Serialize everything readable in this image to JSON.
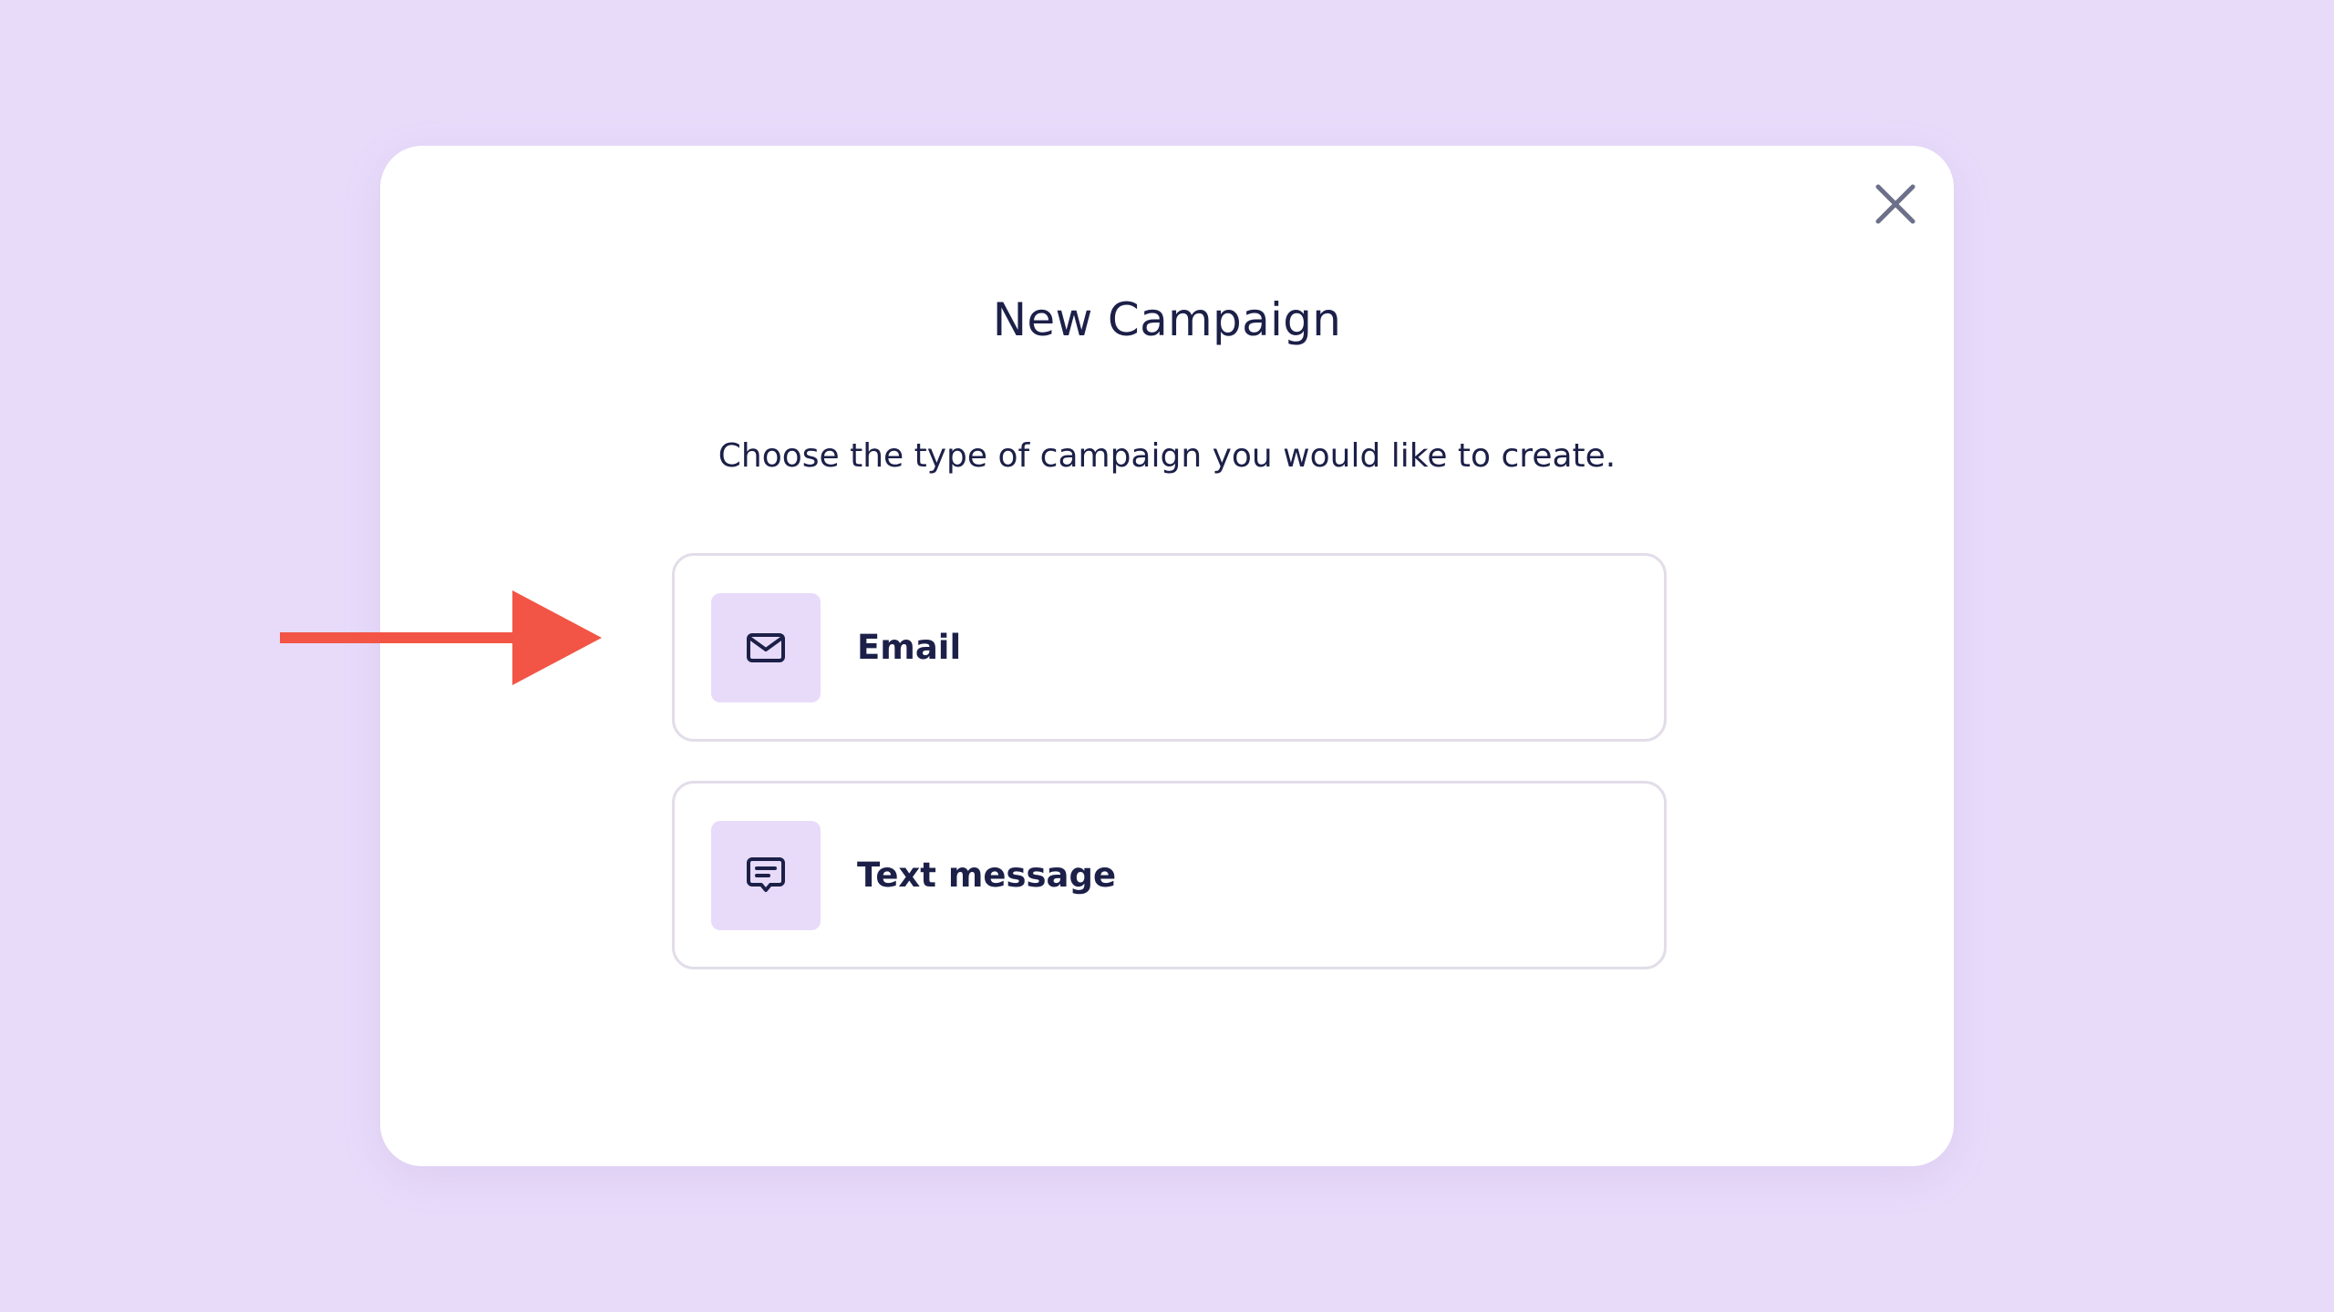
{
  "modal": {
    "title": "New Campaign",
    "subtitle": "Choose the type of campaign you would like to create.",
    "close_icon": "close-icon",
    "options": [
      {
        "label": "Email",
        "icon": "envelope-icon"
      },
      {
        "label": "Text message",
        "icon": "chat-message-icon"
      }
    ]
  },
  "annotation": {
    "icon": "arrow-right-icon",
    "color": "#f25545"
  },
  "colors": {
    "background": "#e8dbfa",
    "card": "#ffffff",
    "text": "#1c2048",
    "icon_tile": "#e8dbfa",
    "option_border": "#e2dde9",
    "close_icon": "#6c7088"
  }
}
